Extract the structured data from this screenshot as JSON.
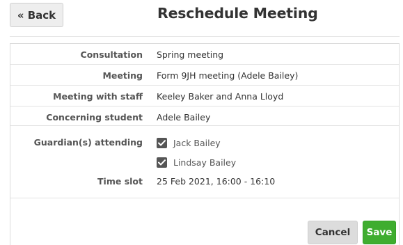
{
  "header": {
    "back_label": "« Back",
    "title": "Reschedule Meeting"
  },
  "details": [
    {
      "label": "Consultation",
      "value": "Spring meeting"
    },
    {
      "label": "Meeting",
      "value": "Form 9JH meeting (Adele Bailey)"
    },
    {
      "label": "Meeting with staff",
      "value": "Keeley Baker and Anna Lloyd"
    },
    {
      "label": "Concerning student",
      "value": "Adele Bailey"
    }
  ],
  "guardians": {
    "label": "Guardian(s) attending",
    "options": [
      {
        "name": "Jack Bailey",
        "checked": true
      },
      {
        "name": "Lindsay Bailey",
        "checked": true
      }
    ]
  },
  "time_slot": {
    "label": "Time slot",
    "value": "25 Feb 2021, 16:00 - 16:10"
  },
  "actions": {
    "cancel_label": "Cancel",
    "save_label": "Save"
  },
  "colors": {
    "save": "#3fad2f",
    "checkbox": "#555555"
  }
}
